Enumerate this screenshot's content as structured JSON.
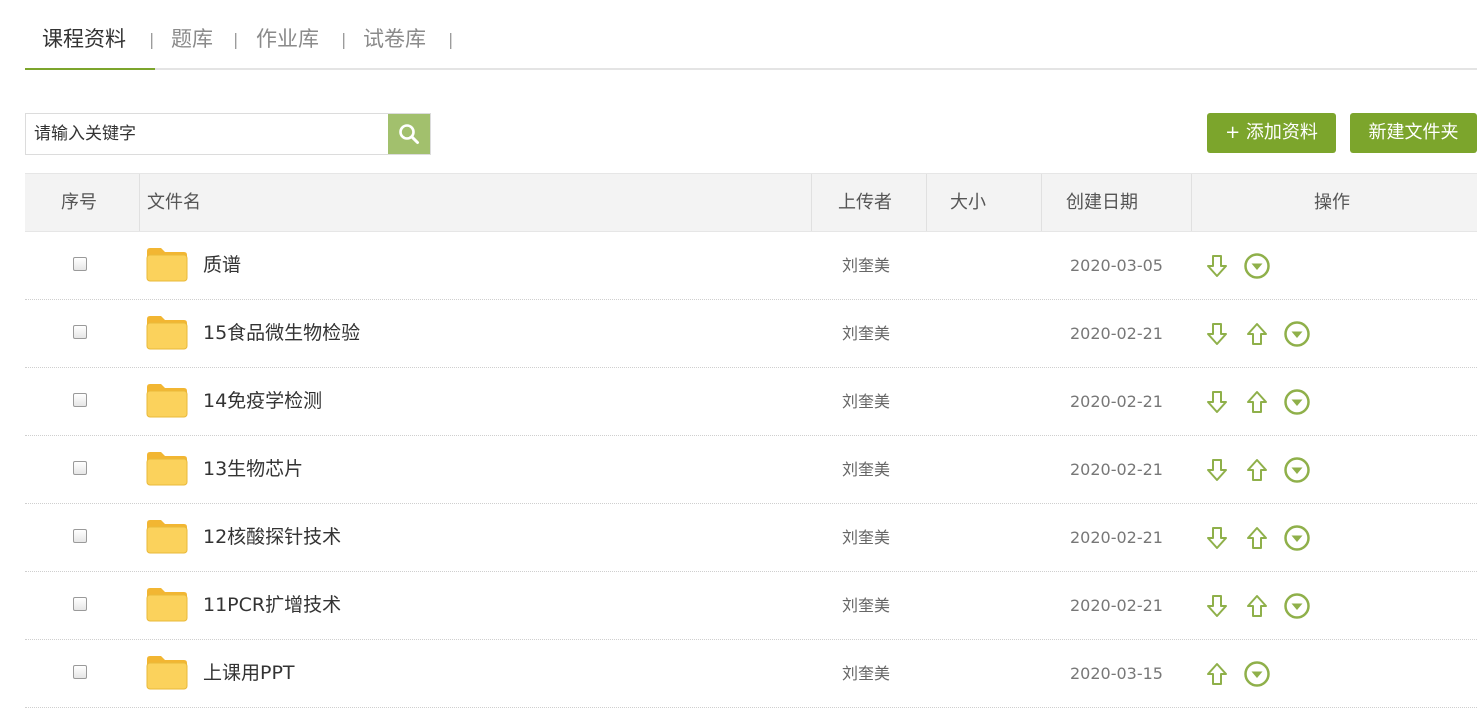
{
  "tabs": [
    {
      "label": "课程资料",
      "active": true
    },
    {
      "label": "题库",
      "active": false
    },
    {
      "label": "作业库",
      "active": false
    },
    {
      "label": "试卷库",
      "active": false
    }
  ],
  "tab_separator": "|",
  "search": {
    "placeholder": "请输入关键字",
    "value": ""
  },
  "actions": {
    "add_label": "+ 添加资料",
    "new_folder_label": "新建文件夹"
  },
  "table": {
    "headers": {
      "index": "序号",
      "name": "文件名",
      "uploader": "上传者",
      "size": "大小",
      "date": "创建日期",
      "ops": "操作"
    },
    "rows": [
      {
        "name": "质谱",
        "uploader": "刘奎美",
        "size": "",
        "date": "2020-03-05",
        "ops": [
          "down",
          "more"
        ]
      },
      {
        "name": "15食品微生物检验",
        "uploader": "刘奎美",
        "size": "",
        "date": "2020-02-21",
        "ops": [
          "down",
          "up",
          "more"
        ]
      },
      {
        "name": "14免疫学检测",
        "uploader": "刘奎美",
        "size": "",
        "date": "2020-02-21",
        "ops": [
          "down",
          "up",
          "more"
        ]
      },
      {
        "name": "13生物芯片",
        "uploader": "刘奎美",
        "size": "",
        "date": "2020-02-21",
        "ops": [
          "down",
          "up",
          "more"
        ]
      },
      {
        "name": "12核酸探针技术",
        "uploader": "刘奎美",
        "size": "",
        "date": "2020-02-21",
        "ops": [
          "down",
          "up",
          "more"
        ]
      },
      {
        "name": "11PCR扩增技术",
        "uploader": "刘奎美",
        "size": "",
        "date": "2020-02-21",
        "ops": [
          "down",
          "up",
          "more"
        ]
      },
      {
        "name": "上课用PPT",
        "uploader": "刘奎美",
        "size": "",
        "date": "2020-03-15",
        "ops": [
          "up",
          "more"
        ]
      }
    ]
  },
  "colors": {
    "accent": "#7ca52c",
    "search_button": "#a2c06d",
    "folder": "#f7c948",
    "op_icon": "#8fb04a"
  },
  "icons": {
    "search": "search-icon",
    "folder": "folder-icon",
    "down": "arrow-down-icon",
    "up": "arrow-up-icon",
    "more": "circle-chevron-down-icon"
  }
}
